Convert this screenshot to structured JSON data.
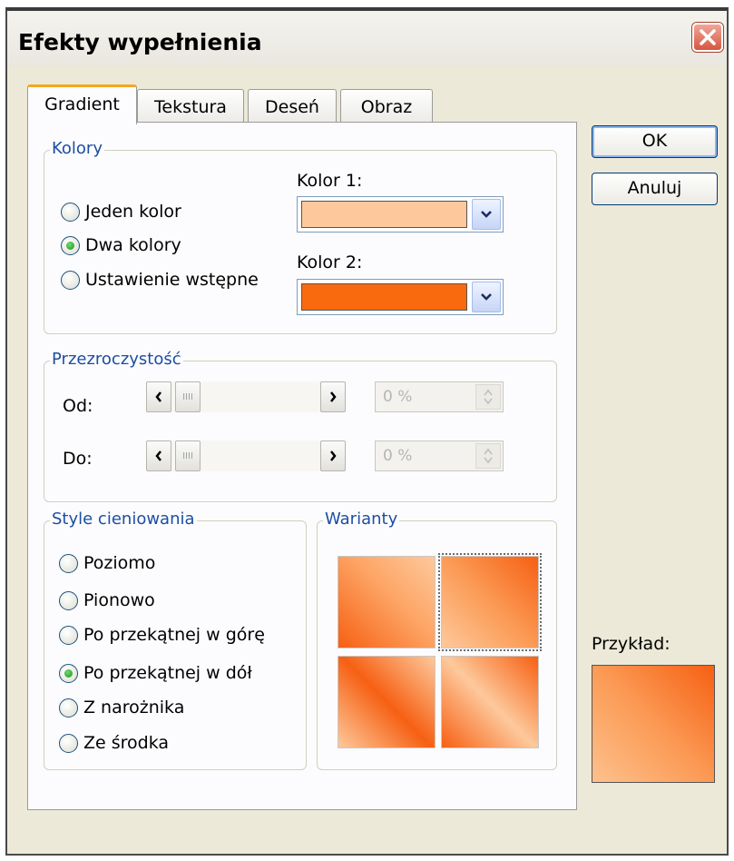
{
  "window": {
    "title": "Efekty wypełnienia"
  },
  "tabs": [
    {
      "label": "Gradient",
      "active": true
    },
    {
      "label": "Tekstura",
      "active": false
    },
    {
      "label": "Deseń",
      "active": false
    },
    {
      "label": "Obraz",
      "active": false
    }
  ],
  "kolory": {
    "legend": "Kolory",
    "options": [
      {
        "label": "Jeden kolor",
        "checked": false
      },
      {
        "label": "Dwa kolory",
        "checked": true
      },
      {
        "label": "Ustawienie wstępne",
        "checked": false
      }
    ],
    "color1": {
      "label": "Kolor 1:",
      "value": "#fdc99c"
    },
    "color2": {
      "label": "Kolor 2:",
      "value": "#f96a0e"
    }
  },
  "transparency": {
    "legend": "Przezroczystość",
    "from": {
      "label": "Od:",
      "value": "0 %",
      "level": 0
    },
    "to": {
      "label": "Do:",
      "value": "0 %",
      "level": 0
    }
  },
  "shading": {
    "legend": "Style cieniowania",
    "options": [
      {
        "label": "Poziomo",
        "checked": false
      },
      {
        "label": "Pionowo",
        "checked": false
      },
      {
        "label": "Po przekątnej w górę",
        "checked": false
      },
      {
        "label": "Po przekątnej w dół",
        "checked": true
      },
      {
        "label": "Z narożnika",
        "checked": false
      },
      {
        "label": "Ze środka",
        "checked": false
      }
    ]
  },
  "variants": {
    "legend": "Warianty",
    "selected_index": 1
  },
  "buttons": {
    "ok": "OK",
    "cancel": "Anuluj"
  },
  "preview": {
    "label": "Przykład:"
  },
  "icons": {
    "close": "close-icon",
    "dropdown": "chevron-down-icon",
    "arrow_left": "arrow-left-icon",
    "arrow_right": "arrow-right-icon",
    "spin": "spin-arrows-icon"
  }
}
